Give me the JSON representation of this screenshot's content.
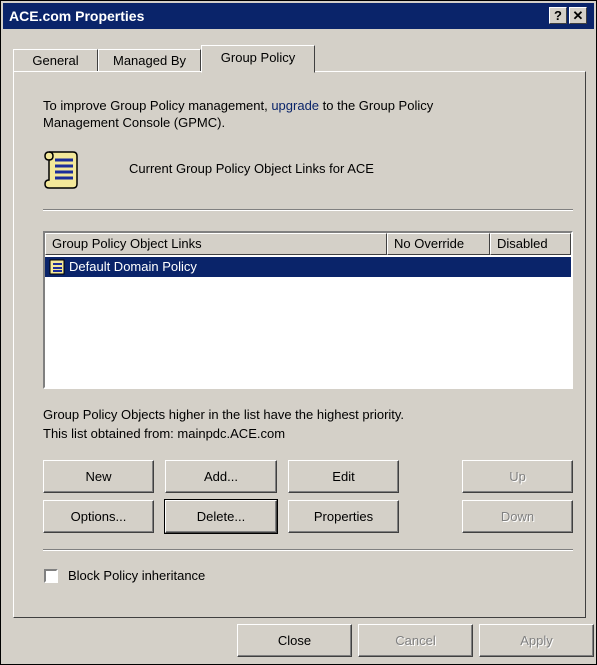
{
  "window": {
    "title": "ACE.com Properties",
    "help_label": "?",
    "close_label": "✕"
  },
  "tabs": [
    {
      "label": "General"
    },
    {
      "label": "Managed By"
    },
    {
      "label": "Group Policy"
    }
  ],
  "intro": {
    "text_before": "To improve Group Policy management, ",
    "link_text": "upgrade",
    "text_after": " to the Group Policy",
    "line2": "Management Console (GPMC)."
  },
  "header_text": "Current Group Policy Object Links for ACE",
  "list": {
    "columns": [
      "Group Policy Object Links",
      "No Override",
      "Disabled"
    ],
    "rows": [
      {
        "name": "Default Domain Policy",
        "no_override": "",
        "disabled": ""
      }
    ]
  },
  "info": {
    "line1": "Group Policy Objects higher in the list have the highest priority.",
    "line2": "This list obtained from: mainpdc.ACE.com"
  },
  "buttons": {
    "new": "New",
    "add": "Add...",
    "edit": "Edit",
    "up": "Up",
    "options": "Options...",
    "delete": "Delete...",
    "properties": "Properties",
    "down": "Down"
  },
  "block_inheritance": {
    "label": "Block Policy inheritance",
    "checked": false
  },
  "footer": {
    "close": "Close",
    "cancel": "Cancel",
    "apply": "Apply"
  }
}
